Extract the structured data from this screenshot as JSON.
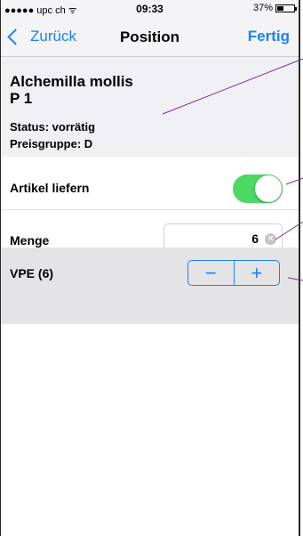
{
  "status_bar": {
    "carrier": "●●●●● upc ch ᯤ",
    "time": "09:33",
    "battery": "37%",
    "battery_level": 0.37
  },
  "nav": {
    "back_label": "Zurück",
    "title": "Position",
    "done_label": "Fertig"
  },
  "item": {
    "name": "Alchemilla mollis",
    "code": "P 1",
    "status": "Status: vorrätig",
    "price_group": "Preisgruppe: D"
  },
  "deliver": {
    "label": "Artikel liefern",
    "enabled": true,
    "toggle_color": "#4cd964"
  },
  "quantity": {
    "label": "Menge",
    "value": "6"
  },
  "vpe": {
    "label": "VPE (6)",
    "minus": "−",
    "plus": "+"
  },
  "colors": {
    "accent": "#1a82f5",
    "callout": "#7a2d8c"
  }
}
